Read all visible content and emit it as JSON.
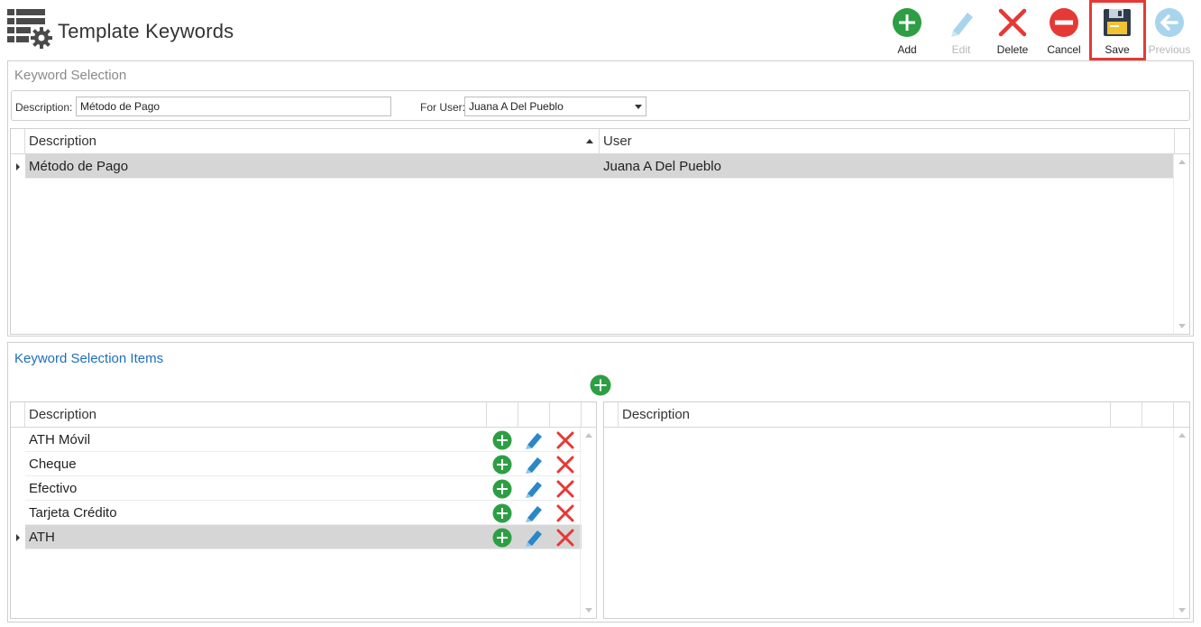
{
  "header": {
    "title": "Template Keywords",
    "icon": "grid-settings-icon"
  },
  "toolbar": {
    "add_label": "Add",
    "edit_label": "Edit",
    "delete_label": "Delete",
    "cancel_label": "Cancel",
    "save_label": "Save",
    "previous_label": "Previous",
    "colors": {
      "add": "#2e9e45",
      "edit_disabled": "#a9d4ee",
      "delete": "#e53935",
      "save_highlight": "#e53935"
    }
  },
  "keyword_selection": {
    "title": "Keyword Selection",
    "description_label": "Description:",
    "description_value": "Método de Pago",
    "for_user_label": "For User:",
    "for_user_value": "Juana A Del Pueblo",
    "grid": {
      "columns": [
        "Description",
        "User"
      ],
      "rows": [
        {
          "description": "Método de Pago",
          "user": "Juana A Del Pueblo",
          "selected": true
        }
      ]
    }
  },
  "keyword_items": {
    "title": "Keyword Selection Items",
    "left_grid": {
      "columns": [
        "Description"
      ],
      "rows": [
        {
          "description": "ATH Móvil",
          "selected": false
        },
        {
          "description": "Cheque",
          "selected": false
        },
        {
          "description": "Efectivo",
          "selected": false
        },
        {
          "description": "Tarjeta Crédito",
          "selected": false
        },
        {
          "description": "ATH",
          "selected": true
        }
      ]
    },
    "right_grid": {
      "columns": [
        "Description"
      ],
      "rows": []
    }
  }
}
